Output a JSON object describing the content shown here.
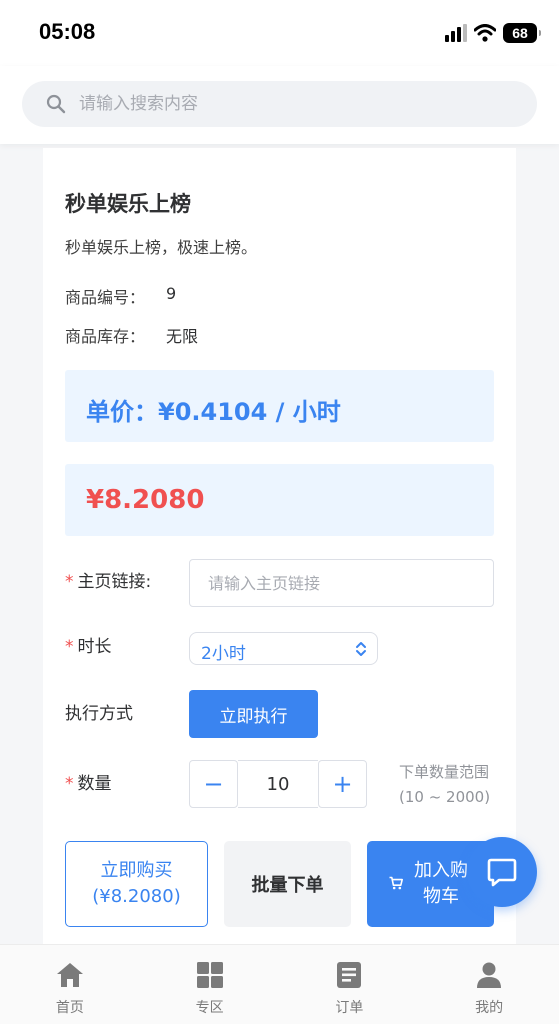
{
  "status_bar": {
    "time": "05:08",
    "battery": "68"
  },
  "search": {
    "placeholder": "请输入搜索内容"
  },
  "product": {
    "title": "秒单娱乐上榜",
    "description": "秒单娱乐上榜，极速上榜。",
    "id_label": "商品编号：",
    "id_value": "9",
    "stock_label": "商品库存：",
    "stock_value": "无限"
  },
  "pricing": {
    "unit_price": "单价：¥0.4104 / 小时",
    "total": "¥8.2080"
  },
  "form": {
    "required_mark": "*",
    "link_label": "主页链接:",
    "link_placeholder": "请输入主页链接",
    "duration_label": "时长",
    "duration_value": "2小时",
    "exec_label": "执行方式",
    "exec_button": "立即执行",
    "quantity_label": "数量",
    "quantity_minus": "−",
    "quantity_value": "10",
    "quantity_plus": "+",
    "range_line1": "下单数量范围",
    "range_line2": "(10 ~ 2000)"
  },
  "actions": {
    "buy_line1": "立即购买",
    "buy_line2": "(¥8.2080)",
    "batch": "批量下单",
    "cart_line1": "加入购",
    "cart_line2": "物车"
  },
  "tabbar": [
    {
      "label": "首页",
      "icon": "home-icon"
    },
    {
      "label": "专区",
      "icon": "grid-icon"
    },
    {
      "label": "订单",
      "icon": "document-icon"
    },
    {
      "label": "我的",
      "icon": "user-icon"
    }
  ],
  "colors": {
    "primary": "#3a84f0",
    "price_red": "#f05050",
    "price_bg": "#ecf5ff",
    "page_bg": "#f5f6f8"
  }
}
